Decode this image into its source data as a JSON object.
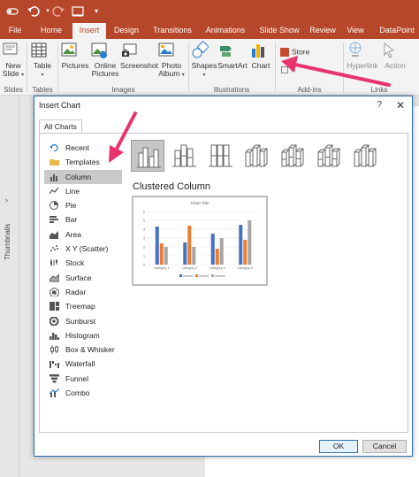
{
  "ribbon_tabs": [
    "File",
    "Home",
    "Insert",
    "Design",
    "Transitions",
    "Animations",
    "Slide Show",
    "Review",
    "View",
    "DataPoint"
  ],
  "ribbon": {
    "new_slide": "New Slide",
    "table": "Table",
    "pictures": "Pictures",
    "online_pictures": "Online Pictures",
    "screenshot": "Screenshot",
    "photo_album": "Photo Album",
    "shapes": "Shapes",
    "smartart": "SmartArt",
    "chart": "Chart",
    "store": "Store",
    "hyperlink": "Hyperlink",
    "action": "Action",
    "groups": {
      "slides": "Slides",
      "tables": "Tables",
      "images": "Images",
      "illustrations": "Illustrations",
      "addins": "Add-ins",
      "links": "Links"
    }
  },
  "thumbnails_label": "Thumbnails",
  "dialog": {
    "title": "Insert Chart",
    "help": "?",
    "close": "✕",
    "tab": "All Charts",
    "chart_types": [
      {
        "label": "Recent",
        "icon": "recent-icon"
      },
      {
        "label": "Templates",
        "icon": "folder-icon"
      },
      {
        "label": "Column",
        "icon": "column-chart-icon"
      },
      {
        "label": "Line",
        "icon": "line-chart-icon"
      },
      {
        "label": "Pie",
        "icon": "pie-chart-icon"
      },
      {
        "label": "Bar",
        "icon": "bar-chart-icon"
      },
      {
        "label": "Area",
        "icon": "area-chart-icon"
      },
      {
        "label": "X Y (Scatter)",
        "icon": "scatter-chart-icon"
      },
      {
        "label": "Stock",
        "icon": "stock-chart-icon"
      },
      {
        "label": "Surface",
        "icon": "surface-chart-icon"
      },
      {
        "label": "Radar",
        "icon": "radar-chart-icon"
      },
      {
        "label": "Treemap",
        "icon": "treemap-chart-icon"
      },
      {
        "label": "Sunburst",
        "icon": "sunburst-chart-icon"
      },
      {
        "label": "Histogram",
        "icon": "histogram-chart-icon"
      },
      {
        "label": "Box & Whisker",
        "icon": "box-whisker-chart-icon"
      },
      {
        "label": "Waterfall",
        "icon": "waterfall-chart-icon"
      },
      {
        "label": "Funnel",
        "icon": "funnel-chart-icon"
      },
      {
        "label": "Combo",
        "icon": "combo-chart-icon"
      }
    ],
    "selected_type": "Column",
    "subtype_title": "Clustered Column",
    "preview": {
      "title": "Chart Title",
      "categories": [
        "Category 1",
        "Category 2",
        "Category 3",
        "Category 4"
      ],
      "series": [
        {
          "name": "Series1",
          "color": "#4472c4",
          "values": [
            4.3,
            2.5,
            3.5,
            4.5
          ]
        },
        {
          "name": "Series2",
          "color": "#ed7d31",
          "values": [
            2.4,
            4.4,
            1.8,
            2.8
          ]
        },
        {
          "name": "Series3",
          "color": "#a5a5a5",
          "values": [
            2,
            2,
            3,
            5
          ]
        }
      ],
      "yticks": [
        "0",
        "1",
        "2",
        "3",
        "4",
        "5",
        "6"
      ]
    },
    "ok": "OK",
    "cancel": "Cancel"
  },
  "colors": {
    "accent": "#b7472a",
    "annotation_arrow": "#e8336d",
    "dialog_border": "#2a6fb5"
  }
}
